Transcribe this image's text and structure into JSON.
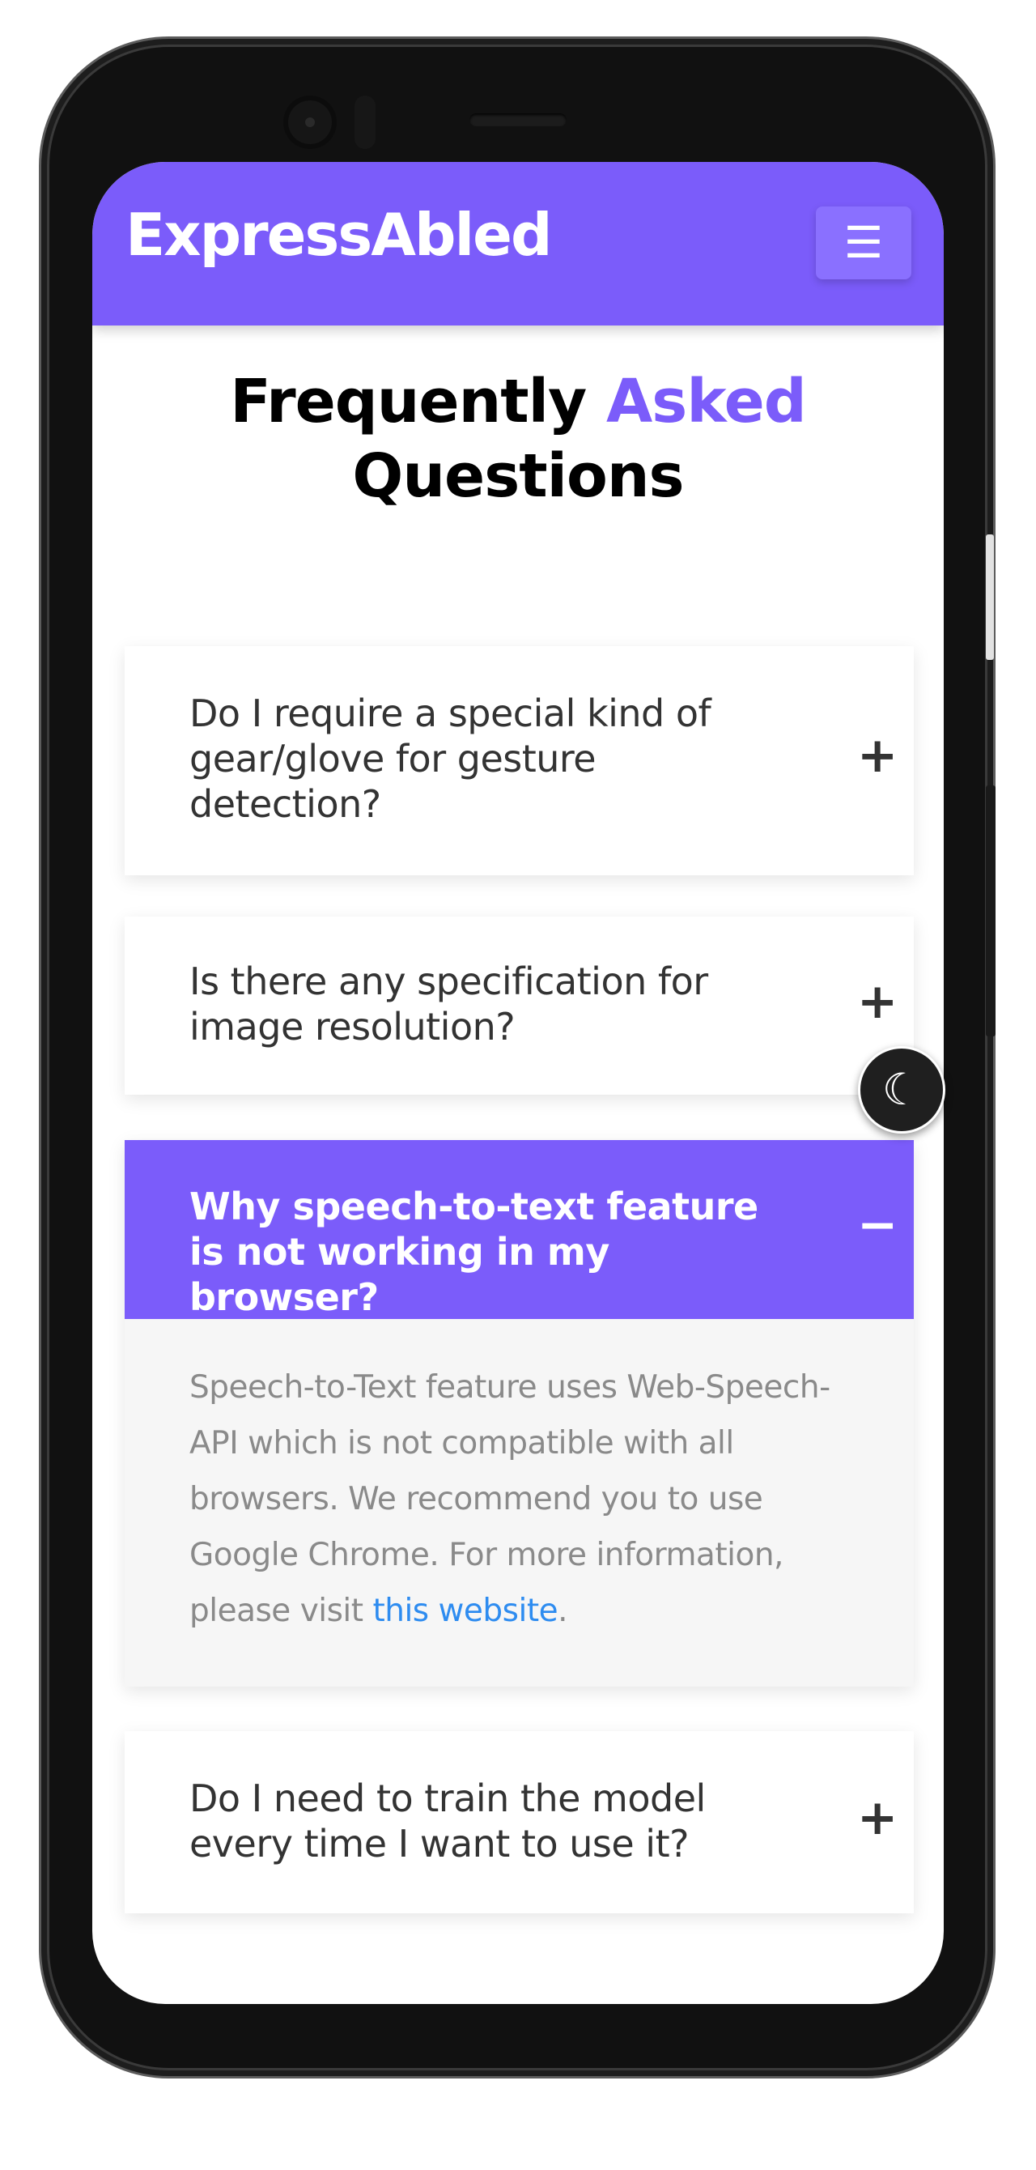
{
  "navbar": {
    "brand": "ExpressAbled",
    "menu_icon": "☰"
  },
  "page": {
    "title_part1": "Frequently ",
    "title_accent": "Asked",
    "title_part2": "Questions"
  },
  "faq": [
    {
      "question": "Do I require a special kind of gear/glove for gesture detection?",
      "toggle": "+",
      "expanded": false
    },
    {
      "question": "Is there any specification for image resolution?",
      "toggle": "+",
      "expanded": false
    },
    {
      "question": "Why speech-to-text feature is not working in my browser?",
      "toggle": "−",
      "expanded": true,
      "answer_text": "Speech-to-Text feature uses Web-Speech-API which is not compatible with all browsers. We recommend you to use Google Chrome. For more information, please visit ",
      "answer_link": "this website",
      "answer_end": "."
    },
    {
      "question": "Do I need to train the model every time I want to use it?",
      "toggle": "+",
      "expanded": false
    }
  ],
  "theme_toggle": {
    "icon": "moon-icon",
    "glyph": "☾"
  },
  "colors": {
    "accent": "#7b5cfa",
    "link": "#2e8cf0"
  }
}
